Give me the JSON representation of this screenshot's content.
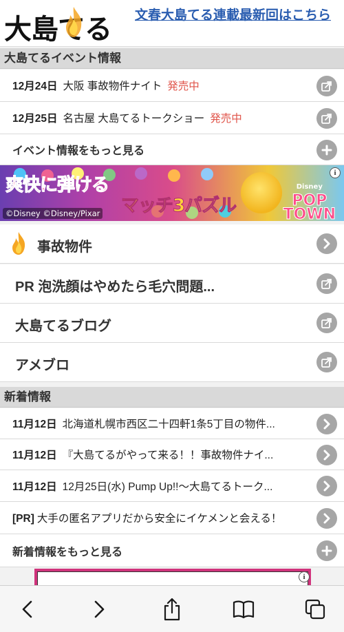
{
  "header": {
    "logo_text": "大島てる",
    "link_text": "文春大島てる連載最新回はこちら"
  },
  "events": {
    "section_title": "大島てるイベント情報",
    "items": [
      {
        "date": "12月24日",
        "text": "大阪 事故物件ナイト",
        "status": "発売中"
      },
      {
        "date": "12月25日",
        "text": "名古屋 大島てるトークショー",
        "status": "発売中"
      }
    ],
    "more_label": "イベント情報をもっと見る"
  },
  "banner": {
    "title_line1": "爽快に弾ける",
    "title_line2": "マッチ3パズル",
    "copyright": "©Disney ©Disney/Pixar",
    "logo_brand": "Disney",
    "logo_line1": "POP",
    "logo_line2": "TOWN",
    "info": "i"
  },
  "menu": [
    {
      "label": "事故物件",
      "icon": "chevron-right-icon"
    },
    {
      "label": "PR 泡洗顔はやめたら毛穴問題...",
      "icon": "external-link-icon"
    },
    {
      "label": "大島てるブログ",
      "icon": "external-link-icon"
    },
    {
      "label": "アメブロ",
      "icon": "external-link-icon"
    }
  ],
  "news": {
    "section_title": "新着情報",
    "items": [
      {
        "date": "11月12日",
        "text": "北海道札幌市西区二十四軒1条5丁目の物件..."
      },
      {
        "date": "11月12日",
        "text": "『大島てるがやって来る！！事故物件ナイ..."
      },
      {
        "date": "11月12日",
        "text": "12月25日(水) Pump Up!!～大島てるトーク..."
      },
      {
        "date": "[PR]",
        "text": "大手の匿名アプリだから安全にイケメンと会える！"
      }
    ],
    "more_label": "新着情報をもっと見る"
  },
  "ad2": {
    "info": "i"
  },
  "toolbar": {
    "items": [
      "back",
      "forward",
      "share",
      "bookmarks",
      "tabs"
    ]
  },
  "colors": {
    "link": "#2a5db0",
    "sale": "#e0544a",
    "button_gray": "#a6a6a6",
    "section_bg": "#d9d9d9"
  }
}
